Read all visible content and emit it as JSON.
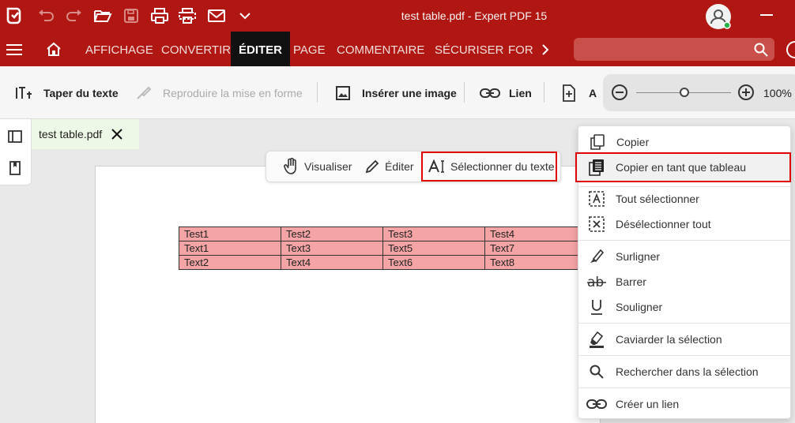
{
  "app": {
    "title": "test table.pdf  -  Expert PDF 15"
  },
  "colors": {
    "brand_red": "#b01712",
    "highlight": "#f4a4a4",
    "selection_outline": "#e00000"
  },
  "titlebar": {
    "icons": [
      "app-logo-icon",
      "undo-icon",
      "redo-icon",
      "open-folder-icon",
      "save-icon",
      "print-icon",
      "scan-icon",
      "email-icon",
      "chevron-down-icon",
      "user-avatar-icon",
      "minimize-icon"
    ]
  },
  "ribbon": {
    "tabs": [
      "AFFICHAGE",
      "CONVERTIR",
      "ÉDITER",
      "PAGE",
      "COMMENTAIRE",
      "SÉCURISER",
      "FOR"
    ],
    "active_tab": "ÉDITER"
  },
  "toolbar": {
    "type_text": "Taper du texte",
    "format_painter": "Reproduire la mise en forme",
    "insert_image": "Insérer une image",
    "link": "Lien",
    "add": "A",
    "zoom": "100%"
  },
  "document_tab": {
    "name": "test table.pdf"
  },
  "modes": {
    "view": "Visualiser",
    "edit": "Éditer",
    "select_text": "Sélectionner du texte"
  },
  "table": {
    "rows": [
      [
        "Test1",
        "Test2",
        "Test3",
        "Test4"
      ],
      [
        "Text1",
        "Text3",
        "Text5",
        "Text7"
      ],
      [
        "Text2",
        "Text4",
        "Text6",
        "Text8"
      ]
    ]
  },
  "context_menu": {
    "copy": "Copier",
    "copy_table": "Copier en tant que tableau",
    "select_all": "Tout sélectionner",
    "deselect_all": "Désélectionner tout",
    "highlight": "Surligner",
    "strikeout": "Barrer",
    "underline": "Souligner",
    "redact": "Caviarder la sélection",
    "search": "Rechercher dans la sélection",
    "create_link": "Créer un lien"
  }
}
